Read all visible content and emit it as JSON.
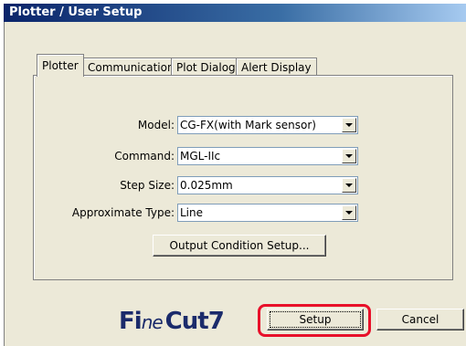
{
  "window": {
    "title": "Plotter / User Setup"
  },
  "tabs": [
    {
      "label": "Plotter",
      "active": true
    },
    {
      "label": "Communication",
      "active": false
    },
    {
      "label": "Plot Dialog",
      "active": false
    },
    {
      "label": "Alert Display",
      "active": false
    }
  ],
  "form": {
    "model_label": "Model:",
    "model_value": "CG-FX(with Mark sensor)",
    "command_label": "Command:",
    "command_value": "MGL-IIc",
    "step_label": "Step Size:",
    "step_value": "0.025mm",
    "approx_label": "Approximate Type:",
    "approx_value": "Line",
    "output_button": "Output Condition Setup..."
  },
  "footer": {
    "logo_text_1": "Fi",
    "logo_text_2": "ne",
    "logo_text_3": "Cut7",
    "setup_button": "Setup",
    "cancel_button": "Cancel"
  },
  "colors": {
    "highlight": "#e8102a",
    "logo": "#1b2b6b"
  }
}
